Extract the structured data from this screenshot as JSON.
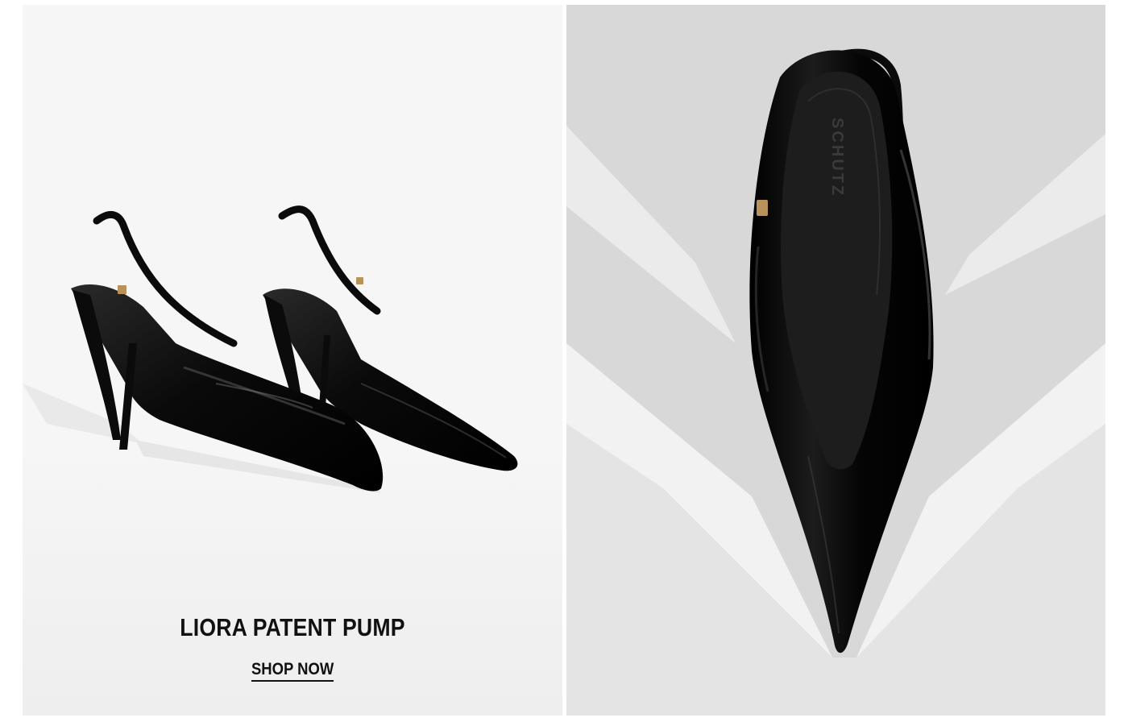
{
  "feature": {
    "product_name": "LIORA PATENT PUMP",
    "cta_label": "SHOP NOW",
    "insole_brand_mark": "SCHUTZ"
  },
  "colors": {
    "left_background": "#f6f6f6",
    "right_background": "#d8d8d8",
    "shoe": "#0b0b0b",
    "buckle": "#b8925a",
    "text": "#111111"
  }
}
